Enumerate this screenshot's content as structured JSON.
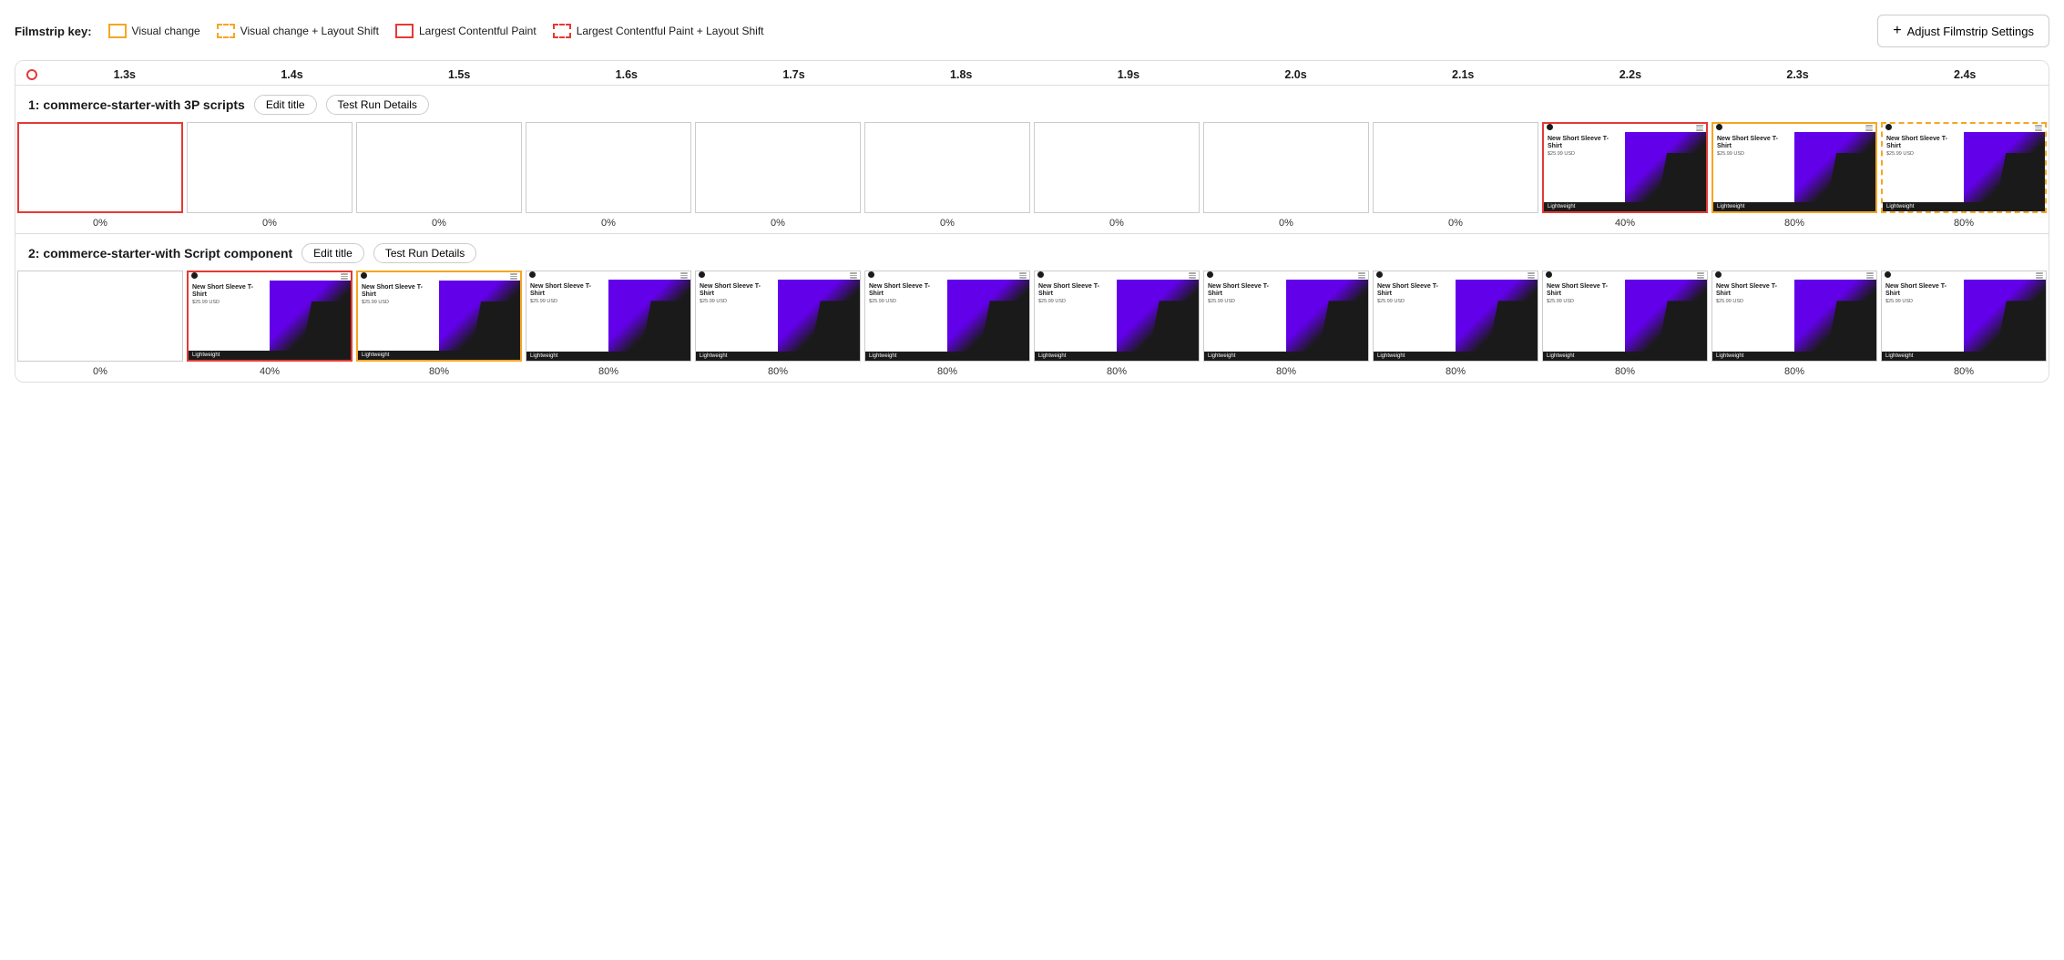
{
  "filmstrip_key": {
    "label": "Filmstrip key:",
    "items": [
      {
        "id": "visual-change",
        "label": "Visual change",
        "border_type": "solid-yellow"
      },
      {
        "id": "visual-change-layout-shift",
        "label": "Visual change + Layout Shift",
        "border_type": "dashed-yellow"
      },
      {
        "id": "lcp",
        "label": "Largest Contentful Paint",
        "border_type": "solid-red"
      },
      {
        "id": "lcp-layout-shift",
        "label": "Largest Contentful Paint + Layout Shift",
        "border_type": "dashed-red"
      }
    ]
  },
  "adjust_button": {
    "label": "Adjust Filmstrip Settings"
  },
  "timeline": {
    "ticks": [
      "1.3s",
      "1.4s",
      "1.5s",
      "1.6s",
      "1.7s",
      "1.8s",
      "1.9s",
      "2.0s",
      "2.1s",
      "2.2s",
      "2.3s",
      "2.4s"
    ]
  },
  "rows": [
    {
      "id": "row1",
      "title": "1: commerce-starter-with 3P scripts",
      "edit_title_label": "Edit title",
      "test_run_label": "Test Run Details",
      "frames": [
        {
          "border": "red-solid",
          "has_content": false,
          "percent": "0%"
        },
        {
          "border": "none",
          "has_content": false,
          "percent": "0%"
        },
        {
          "border": "none",
          "has_content": false,
          "percent": "0%"
        },
        {
          "border": "none",
          "has_content": false,
          "percent": "0%"
        },
        {
          "border": "none",
          "has_content": false,
          "percent": "0%"
        },
        {
          "border": "none",
          "has_content": false,
          "percent": "0%"
        },
        {
          "border": "none",
          "has_content": false,
          "percent": "0%"
        },
        {
          "border": "none",
          "has_content": false,
          "percent": "0%"
        },
        {
          "border": "none",
          "has_content": false,
          "percent": "0%"
        },
        {
          "border": "red-solid",
          "has_content": true,
          "percent": "40%"
        },
        {
          "border": "yellow-solid",
          "has_content": true,
          "percent": "80%"
        },
        {
          "border": "yellow-dashed",
          "has_content": true,
          "percent": "80%"
        }
      ]
    },
    {
      "id": "row2",
      "title": "2: commerce-starter-with Script component",
      "edit_title_label": "Edit title",
      "test_run_label": "Test Run Details",
      "frames": [
        {
          "border": "none",
          "has_content": false,
          "percent": "0%"
        },
        {
          "border": "red-solid",
          "has_content": true,
          "percent": "40%"
        },
        {
          "border": "yellow-solid",
          "has_content": true,
          "percent": "80%"
        },
        {
          "border": "none",
          "has_content": true,
          "percent": "80%"
        },
        {
          "border": "none",
          "has_content": true,
          "percent": "80%"
        },
        {
          "border": "none",
          "has_content": true,
          "percent": "80%"
        },
        {
          "border": "none",
          "has_content": true,
          "percent": "80%"
        },
        {
          "border": "none",
          "has_content": true,
          "percent": "80%"
        },
        {
          "border": "none",
          "has_content": true,
          "percent": "80%"
        },
        {
          "border": "none",
          "has_content": true,
          "percent": "80%"
        },
        {
          "border": "none",
          "has_content": true,
          "percent": "80%"
        },
        {
          "border": "none",
          "has_content": true,
          "percent": "80%"
        }
      ]
    }
  ],
  "product_card": {
    "title": "New Short Sleeve T-Shirt",
    "price": "$25.99 USD",
    "bottom_label": "Lightweight"
  }
}
